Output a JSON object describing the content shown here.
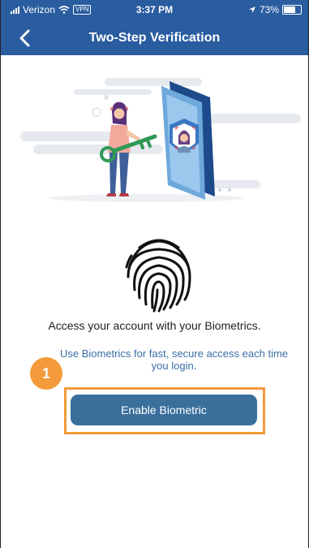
{
  "status_bar": {
    "carrier": "Verizon",
    "vpn": "VPN",
    "time": "3:37 PM",
    "battery": "73%"
  },
  "header": {
    "title": "Two-Step Verification"
  },
  "content": {
    "headline": "Access your account with your Biometrics.",
    "description": "Use Biometrics for fast, secure access each time you login."
  },
  "annotation": {
    "step": "1"
  },
  "actions": {
    "enable_label": "Enable Biometric"
  },
  "colors": {
    "header": "#2a5ca0",
    "button": "#3a6f9c",
    "annotation": "#f39a3a",
    "description_text": "#3a6ea5"
  }
}
